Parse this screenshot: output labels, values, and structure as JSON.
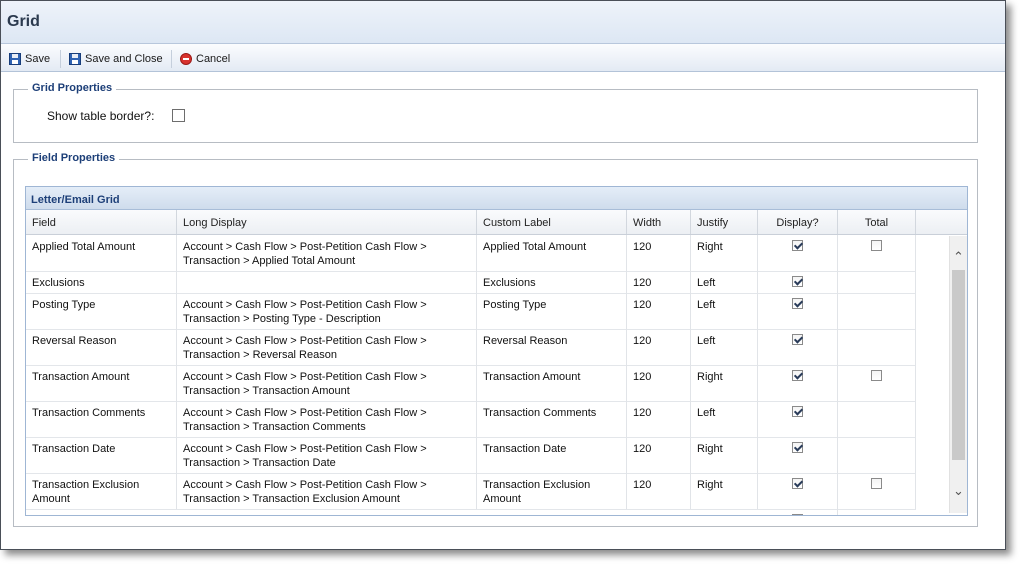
{
  "window": {
    "title": "Grid"
  },
  "toolbar": {
    "save_label": "Save",
    "save_close_label": "Save and Close",
    "cancel_label": "Cancel"
  },
  "grid_properties": {
    "legend": "Grid Properties",
    "show_border_label": "Show table border?:",
    "show_border_checked": false
  },
  "field_properties": {
    "legend": "Field Properties",
    "panel_title": "Letter/Email Grid",
    "columns": [
      "Field",
      "Long Display",
      "Custom Label",
      "Width",
      "Justify",
      "Display?",
      "Total"
    ],
    "rows": [
      {
        "field": "Applied Total Amount",
        "long_display": "Account > Cash Flow > Post-Petition Cash Flow > Transaction > Applied Total Amount",
        "custom_label": "Applied Total Amount",
        "width": "120",
        "justify": "Right",
        "display": true,
        "total": false,
        "has_total": true
      },
      {
        "field": "Exclusions",
        "long_display": "",
        "custom_label": "Exclusions",
        "width": "120",
        "justify": "Left",
        "display": true,
        "total": false,
        "has_total": false
      },
      {
        "field": "Posting Type",
        "long_display": "Account > Cash Flow > Post-Petition Cash Flow > Transaction > Posting Type - Description",
        "custom_label": "Posting Type",
        "width": "120",
        "justify": "Left",
        "display": true,
        "total": false,
        "has_total": false
      },
      {
        "field": "Reversal Reason",
        "long_display": "Account > Cash Flow > Post-Petition Cash Flow > Transaction > Reversal Reason",
        "custom_label": "Reversal Reason",
        "width": "120",
        "justify": "Left",
        "display": true,
        "total": false,
        "has_total": false
      },
      {
        "field": "Transaction Amount",
        "long_display": "Account > Cash Flow > Post-Petition Cash Flow > Transaction > Transaction Amount",
        "custom_label": "Transaction Amount",
        "width": "120",
        "justify": "Right",
        "display": true,
        "total": false,
        "has_total": true
      },
      {
        "field": "Transaction Comments",
        "long_display": "Account > Cash Flow > Post-Petition Cash Flow > Transaction > Transaction Comments",
        "custom_label": "Transaction Comments",
        "width": "120",
        "justify": "Left",
        "display": true,
        "total": false,
        "has_total": false
      },
      {
        "field": "Transaction Date",
        "long_display": "Account > Cash Flow > Post-Petition Cash Flow > Transaction > Transaction Date",
        "custom_label": "Transaction Date",
        "width": "120",
        "justify": "Right",
        "display": true,
        "total": false,
        "has_total": false
      },
      {
        "field": "Transaction Exclusion Amount",
        "long_display": "Account > Cash Flow > Post-Petition Cash Flow > Transaction > Transaction Exclusion Amount",
        "custom_label": "Transaction Exclusion Amount",
        "width": "120",
        "justify": "Right",
        "display": true,
        "total": false,
        "has_total": true
      }
    ]
  },
  "colors": {
    "legend_text": "#1d3f78",
    "title_bar": "#dde7f4",
    "panel_border": "#9fb6d4"
  }
}
